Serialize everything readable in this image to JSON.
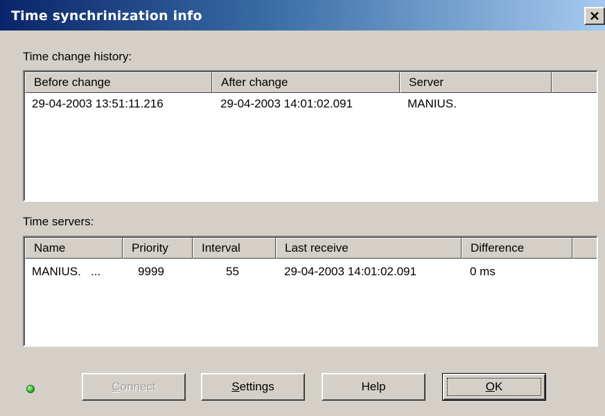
{
  "window": {
    "title": "Time synchrinization info"
  },
  "history": {
    "label": "Time change history:",
    "columns": [
      "Before change",
      "After change",
      "Server",
      ""
    ],
    "rows": [
      [
        "29-04-2003 13:51:11.216",
        "29-04-2003 14:01:02.091",
        "MANIUS."
      ]
    ]
  },
  "servers": {
    "label": "Time servers:",
    "columns": [
      "Name",
      "Priority",
      "Interval",
      "Last receive",
      "Difference",
      ""
    ],
    "rows": [
      [
        "MANIUS.   ...",
        "9999",
        "55",
        "29-04-2003 14:01:02.091",
        "0 ms"
      ]
    ]
  },
  "status": {
    "led_color": "#28c020",
    "icon": "status-led-icon"
  },
  "buttons": {
    "connect": "Connect",
    "settings": "Settings",
    "help": "Help",
    "ok": "OK"
  }
}
